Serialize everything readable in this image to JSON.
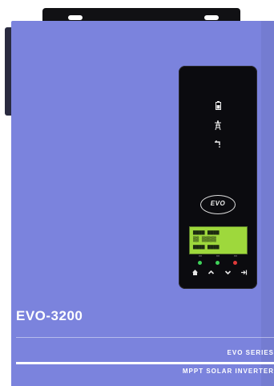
{
  "product": {
    "model": "EVO-3200",
    "series": "EVO SERIES",
    "subtitle": "MPPT SOLAR INVERTER",
    "logo": "EVO"
  },
  "colors": {
    "body": "#7b83dd",
    "panel": "#0b0b0f",
    "lcd": "#9ed83c",
    "led_green": "#3fd35a",
    "led_red": "#e03a3a"
  },
  "icons": {
    "indicators": [
      "battery-icon",
      "grid-tower-icon",
      "faucet-icon"
    ],
    "buttons": [
      "home-icon",
      "up-arrow-icon",
      "down-arrow-icon",
      "enter-icon"
    ]
  }
}
